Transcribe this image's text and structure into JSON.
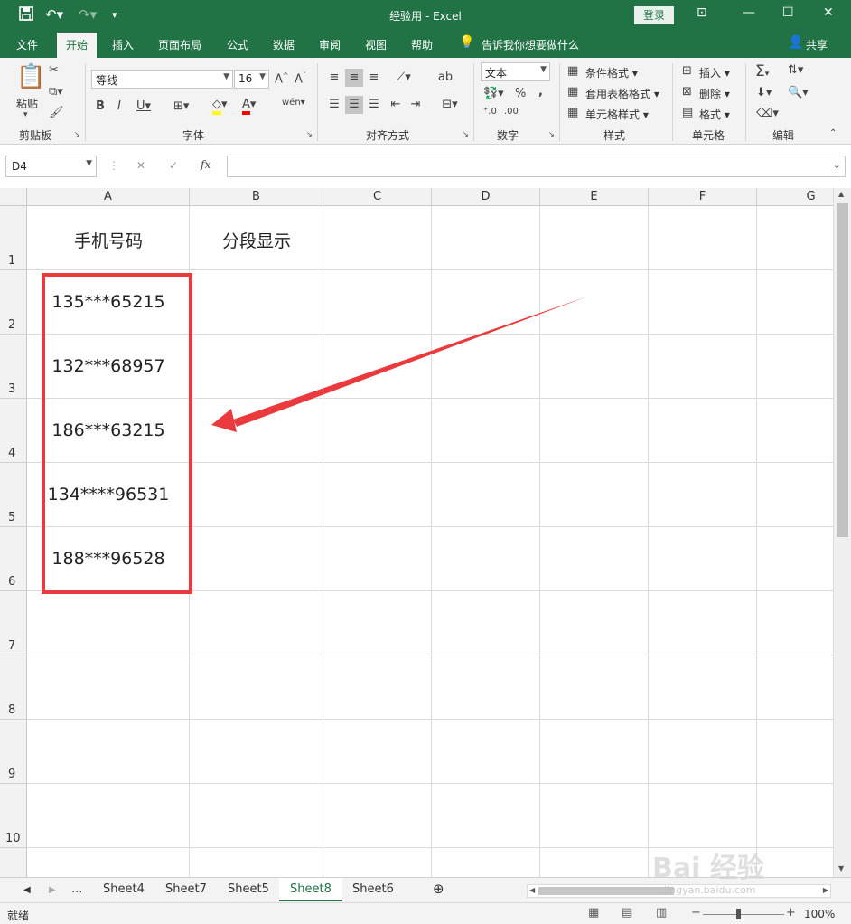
{
  "window": {
    "title": "经验用 - Excel",
    "login_label": "登录",
    "share_label": "共享"
  },
  "tabs": [
    "文件",
    "开始",
    "插入",
    "页面布局",
    "公式",
    "数据",
    "审阅",
    "视图",
    "帮助"
  ],
  "tell_me": "告诉我你想要做什么",
  "ribbon": {
    "paste_label": "粘贴",
    "font_name": "等线",
    "font_size": "16",
    "number_format": "文本",
    "styles": {
      "conditional": "条件格式",
      "table": "套用表格格式",
      "cell": "单元格样式"
    },
    "cells": {
      "insert": "插入",
      "delete": "删除",
      "format": "格式"
    },
    "groups": {
      "clipboard": "剪贴板",
      "font": "字体",
      "alignment": "对齐方式",
      "number": "数字",
      "styles": "样式",
      "cells": "单元格",
      "editing": "编辑"
    }
  },
  "formula_bar": {
    "name_box": "D4",
    "formula": ""
  },
  "columns": [
    "A",
    "B",
    "C",
    "D",
    "E",
    "F",
    "G"
  ],
  "rows": [
    "1",
    "2",
    "3",
    "4",
    "5",
    "6",
    "7",
    "8",
    "9",
    "10"
  ],
  "cells": {
    "A1": "手机号码",
    "B1": "分段显示",
    "A2": "135***65215",
    "A3": "132***68957",
    "A4": "186***63215",
    "A5": "134****96531",
    "A6": "188***96528"
  },
  "sheets": {
    "nav_more": "...",
    "tabs": [
      "Sheet4",
      "Sheet7",
      "Sheet5",
      "Sheet8",
      "Sheet6"
    ],
    "active": "Sheet8"
  },
  "status": {
    "mode": "就绪",
    "zoom": "100%"
  },
  "watermark": "Bai 经验",
  "watermark_url": "jingyan.baidu.com",
  "colors": {
    "excel_green": "#217346",
    "highlight_red": "#ea3a3e"
  }
}
